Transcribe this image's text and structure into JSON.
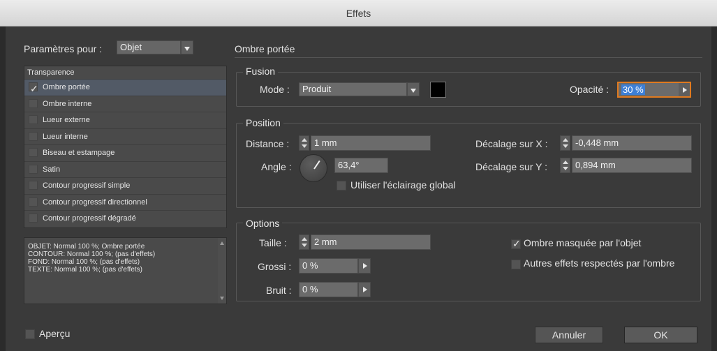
{
  "window": {
    "title": "Effets"
  },
  "params": {
    "label": "Paramètres pour :",
    "value": "Objet"
  },
  "effects_list": {
    "header": "Transparence",
    "items": [
      {
        "label": "Ombre portée",
        "checked": true,
        "selected": true
      },
      {
        "label": "Ombre interne",
        "checked": false
      },
      {
        "label": "Lueur externe",
        "checked": false
      },
      {
        "label": "Lueur interne",
        "checked": false
      },
      {
        "label": "Biseau et estampage",
        "checked": false
      },
      {
        "label": "Satin",
        "checked": false
      },
      {
        "label": "Contour progressif simple",
        "checked": false
      },
      {
        "label": "Contour progressif directionnel",
        "checked": false
      },
      {
        "label": "Contour progressif dégradé",
        "checked": false
      }
    ]
  },
  "summary": {
    "lines": [
      "OBJET: Normal 100 %; Ombre portée",
      "CONTOUR: Normal 100 %; (pas d'effets)",
      "FOND: Normal 100 %; (pas d'effets)",
      "TEXTE: Normal 100 %; (pas d'effets)"
    ]
  },
  "panel": {
    "title": "Ombre portée"
  },
  "fusion": {
    "title": "Fusion",
    "mode_label": "Mode :",
    "mode_value": "Produit",
    "color": "#000000",
    "opacity_label": "Opacité :",
    "opacity_value": "30 %"
  },
  "position": {
    "title": "Position",
    "distance_label": "Distance :",
    "distance_value": "1 mm",
    "angle_label": "Angle :",
    "angle_value": "63,4°",
    "global_light_label": "Utiliser l'éclairage global",
    "offset_x_label": "Décalage sur X :",
    "offset_x_value": "-0,448 mm",
    "offset_y_label": "Décalage sur Y :",
    "offset_y_value": "0,894 mm"
  },
  "options": {
    "title": "Options",
    "size_label": "Taille :",
    "size_value": "2 mm",
    "spread_label": "Grossi :",
    "spread_value": "0 %",
    "noise_label": "Bruit :",
    "noise_value": "0 %",
    "knockout_label": "Ombre masquée par l'objet",
    "honor_label": "Autres effets respectés par l'ombre"
  },
  "footer": {
    "preview_label": "Aperçu",
    "cancel_label": "Annuler",
    "ok_label": "OK"
  }
}
